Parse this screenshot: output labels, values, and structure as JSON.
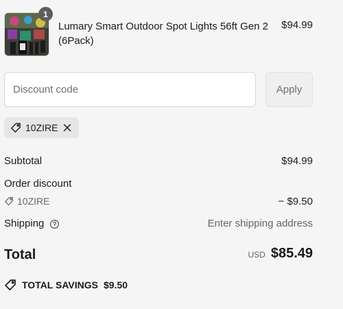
{
  "line_item": {
    "quantity": "1",
    "title": "Lumary Smart Outdoor Spot Lights 56ft Gen 2 (6Pack)",
    "price": "$94.99",
    "image_icon": "product-thumbnail-icon"
  },
  "discount": {
    "placeholder": "Discount code",
    "apply_label": "Apply",
    "applied_code": "10ZIRE"
  },
  "summary": {
    "subtotal_label": "Subtotal",
    "subtotal_value": "$94.99",
    "order_discount_label": "Order discount",
    "discount_code": "10ZIRE",
    "discount_value": "− $9.50",
    "shipping_label": "Shipping",
    "shipping_value": "Enter shipping address",
    "total_label": "Total",
    "currency": "USD",
    "total_value": "$85.49",
    "savings_label": "TOTAL SAVINGS",
    "savings_value": "$9.50"
  },
  "icons": {
    "tag": "tag-icon",
    "close": "close-icon",
    "info": "info-icon"
  },
  "colors": {
    "background": "#f5f5f5",
    "text": "#1a1a1a",
    "muted": "#666666",
    "badge": "#5e5e5e"
  }
}
